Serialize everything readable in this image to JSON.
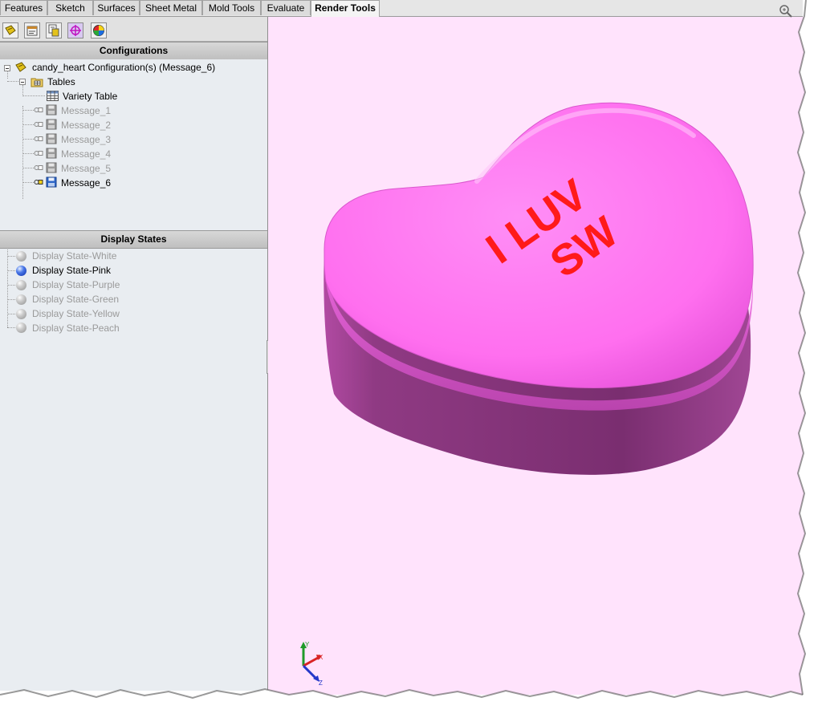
{
  "tabs": [
    {
      "label": "Features",
      "active": false
    },
    {
      "label": "Sketch",
      "active": false
    },
    {
      "label": "Surfaces",
      "active": false
    },
    {
      "label": "Sheet Metal",
      "active": false
    },
    {
      "label": "Mold Tools",
      "active": false
    },
    {
      "label": "Evaluate",
      "active": false
    },
    {
      "label": "Render Tools",
      "active": true
    }
  ],
  "icon_toolbar": [
    "feature-manager-icon",
    "property-manager-icon",
    "configuration-manager-icon",
    "dimxpert-manager-icon",
    "display-manager-icon"
  ],
  "configurations": {
    "header": "Configurations",
    "root_label": "candy_heart Configuration(s)  (Message_6)",
    "tables_label": "Tables",
    "variety_table_label": "Variety Table",
    "items": [
      {
        "label": "Message_1",
        "active": false
      },
      {
        "label": "Message_2",
        "active": false
      },
      {
        "label": "Message_3",
        "active": false
      },
      {
        "label": "Message_4",
        "active": false
      },
      {
        "label": "Message_5",
        "active": false
      },
      {
        "label": "Message_6",
        "active": true
      }
    ]
  },
  "display_states": {
    "header": "Display States",
    "items": [
      {
        "label": "Display State-White",
        "active": false
      },
      {
        "label": "Display State-Pink",
        "active": true
      },
      {
        "label": "Display State-Purple",
        "active": false
      },
      {
        "label": "Display State-Green",
        "active": false
      },
      {
        "label": "Display State-Yellow",
        "active": false
      },
      {
        "label": "Display State-Peach",
        "active": false
      }
    ]
  },
  "model": {
    "text_line1": "I LUV",
    "text_line2": "SW",
    "top_color": "#ff7cf2",
    "side_color": "#8a2f7c",
    "text_color": "#ff1a1a"
  },
  "viewport": {
    "background": "#ffe3fc",
    "triad_labels": {
      "x": "X",
      "y": "Y",
      "z": "Z"
    }
  }
}
